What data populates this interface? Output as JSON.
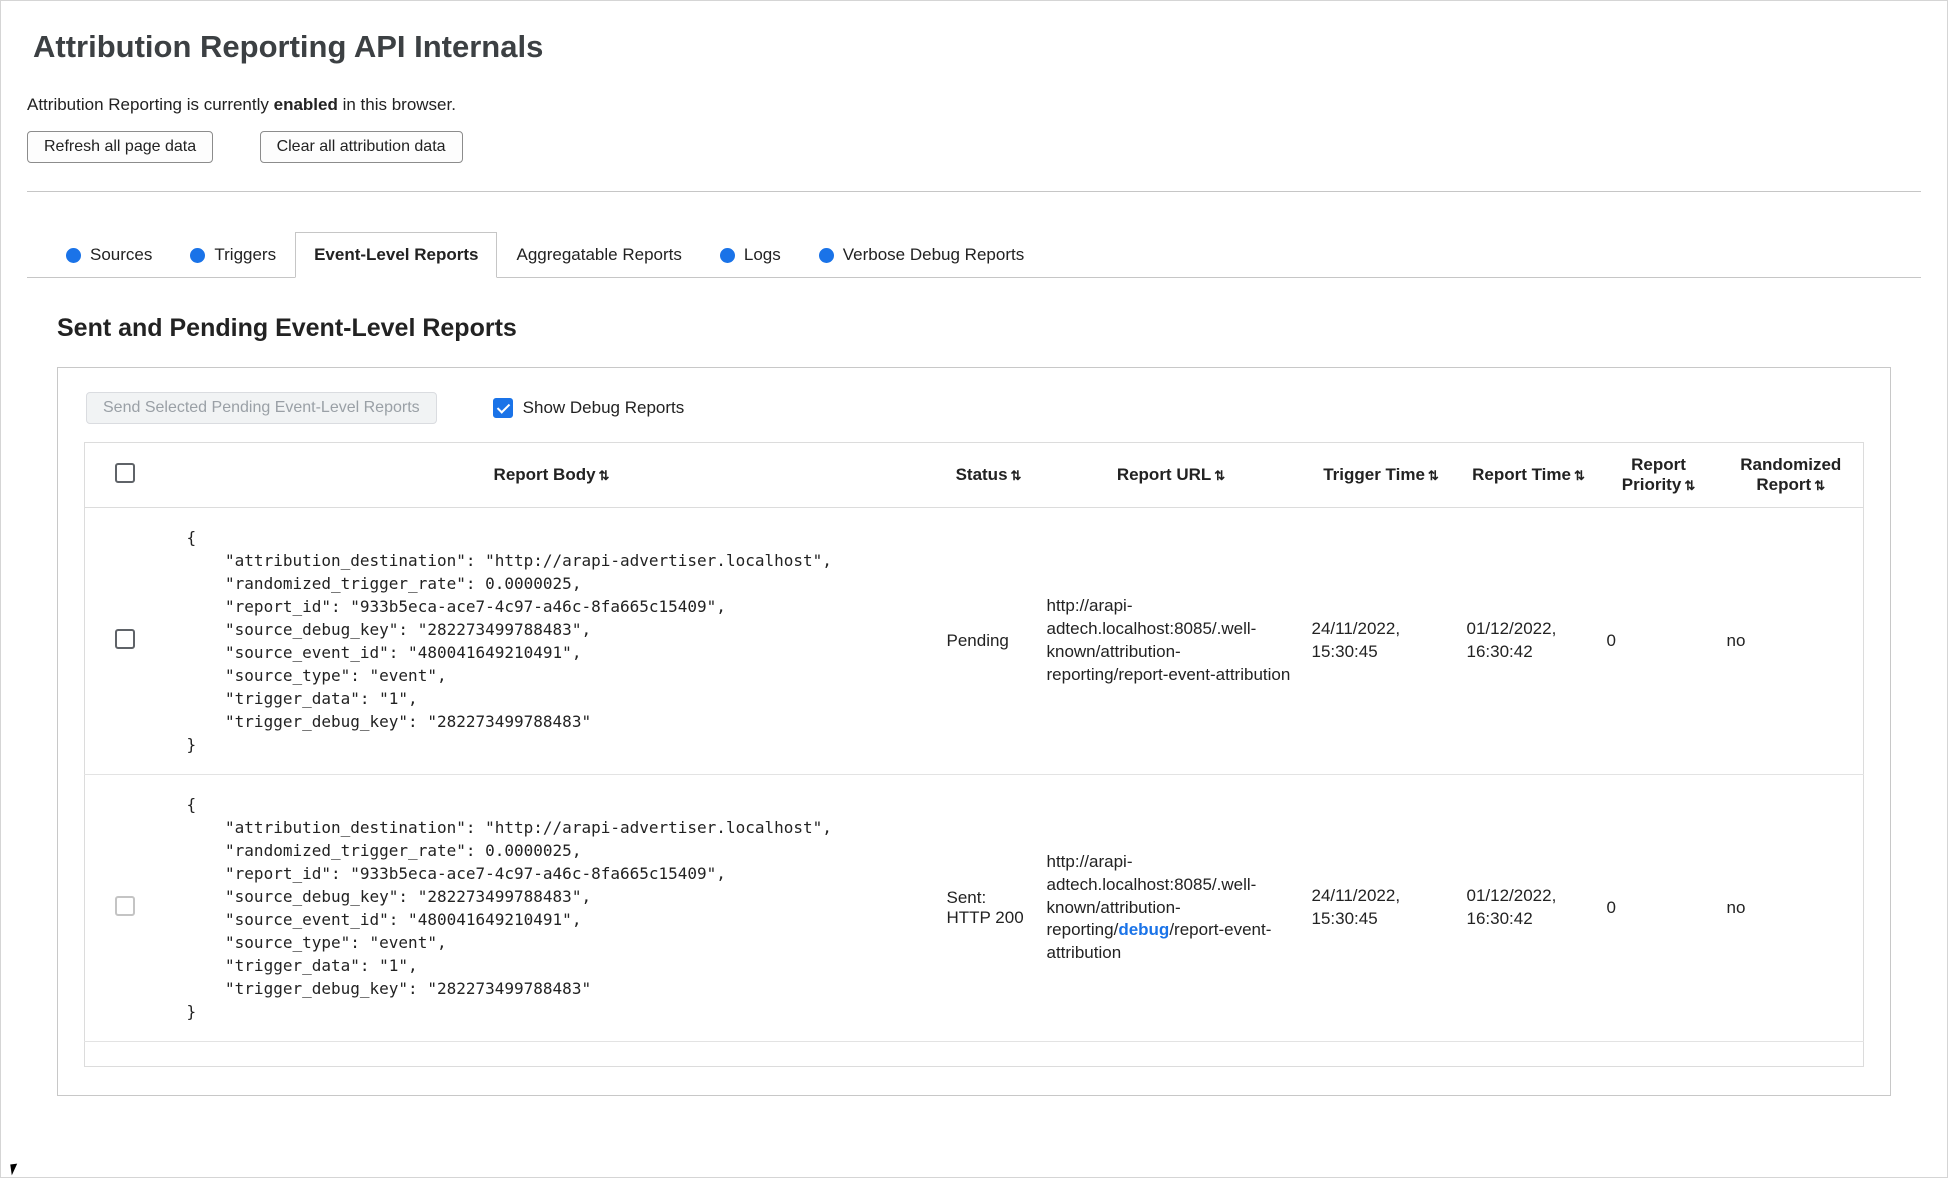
{
  "colors": {
    "accent_blue": "#1a73e8"
  },
  "page": {
    "title": "Attribution Reporting API Internals",
    "status_prefix": "Attribution Reporting is currently ",
    "status_bold": "enabled",
    "status_suffix": " in this browser.",
    "refresh_button_label": "Refresh all page data",
    "clear_button_label": "Clear all attribution data"
  },
  "tabs": [
    {
      "label": "Sources",
      "has_notification_dot": true,
      "active": false
    },
    {
      "label": "Triggers",
      "has_notification_dot": true,
      "active": false
    },
    {
      "label": "Event-Level Reports",
      "has_notification_dot": false,
      "active": true
    },
    {
      "label": "Aggregatable Reports",
      "has_notification_dot": false,
      "active": false
    },
    {
      "label": "Logs",
      "has_notification_dot": true,
      "active": false
    },
    {
      "label": "Verbose Debug Reports",
      "has_notification_dot": true,
      "active": false
    }
  ],
  "section": {
    "heading": "Sent and Pending Event-Level Reports",
    "send_button_label": "Send Selected Pending Event-Level Reports",
    "show_debug_label": "Show Debug Reports",
    "show_debug_checked": true
  },
  "table": {
    "sort_icon": "⇅",
    "headers": {
      "report_body": "Report Body",
      "status": "Status",
      "report_url": "Report URL",
      "trigger_time": "Trigger Time",
      "report_time": "Report Time",
      "report_priority": "Report Priority",
      "randomized_report": "Randomized Report"
    },
    "rows": [
      {
        "report_body": "{\n    \"attribution_destination\": \"http://arapi-advertiser.localhost\",\n    \"randomized_trigger_rate\": 0.0000025,\n    \"report_id\": \"933b5eca-ace7-4c97-a46c-8fa665c15409\",\n    \"source_debug_key\": \"282273499788483\",\n    \"source_event_id\": \"480041649210491\",\n    \"source_type\": \"event\",\n    \"trigger_data\": \"1\",\n    \"trigger_debug_key\": \"282273499788483\"\n}",
        "status": "Pending",
        "report_url_prefix": "http://arapi-adtech.localhost:8085/.well-known/attribution-reporting/",
        "report_url_debug": "",
        "report_url_suffix": "report-event-attribution",
        "trigger_time": "24/11/2022, 15:30:45",
        "report_time": "01/12/2022, 16:30:42",
        "report_priority": "0",
        "randomized_report": "no"
      },
      {
        "report_body": "{\n    \"attribution_destination\": \"http://arapi-advertiser.localhost\",\n    \"randomized_trigger_rate\": 0.0000025,\n    \"report_id\": \"933b5eca-ace7-4c97-a46c-8fa665c15409\",\n    \"source_debug_key\": \"282273499788483\",\n    \"source_event_id\": \"480041649210491\",\n    \"source_type\": \"event\",\n    \"trigger_data\": \"1\",\n    \"trigger_debug_key\": \"282273499788483\"\n}",
        "status": "Sent: HTTP 200",
        "report_url_prefix": "http://arapi-adtech.localhost:8085/.well-known/attribution-reporting/",
        "report_url_debug": "debug",
        "report_url_suffix": "/report-event-attribution",
        "trigger_time": "24/11/2022, 15:30:45",
        "report_time": "01/12/2022, 16:30:42",
        "report_priority": "0",
        "randomized_report": "no"
      }
    ]
  }
}
